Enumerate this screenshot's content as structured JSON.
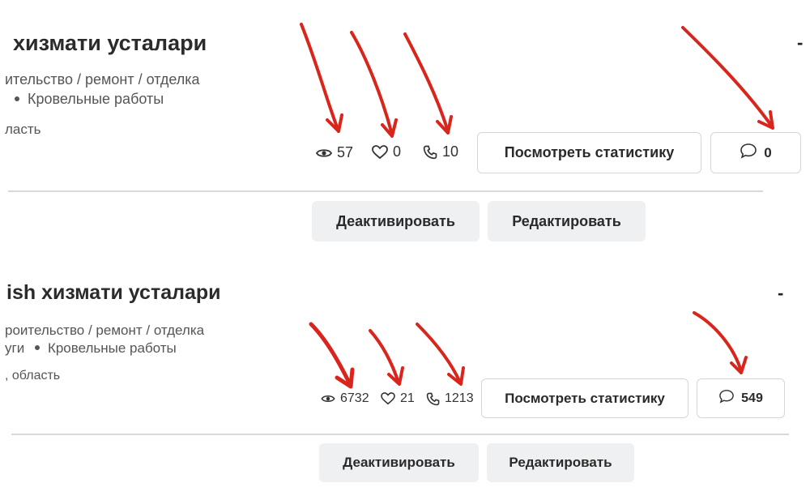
{
  "cards": [
    {
      "title": "хизмати усталари",
      "category_path": "ительство / ремонт / отделка",
      "subcategory": "Кровельные работы",
      "region": "ласть",
      "stats": {
        "views": "57",
        "likes": "0",
        "calls": "10"
      },
      "buttons": {
        "statistics": "Посмотреть статистику",
        "deactivate": "Деактивировать",
        "edit": "Редактировать"
      },
      "messages": "0",
      "more": "-"
    },
    {
      "title": "ish хизмати усталари",
      "category_path": "роительство / ремонт / отделка",
      "subcategory_prefix": "уги",
      "subcategory": "Кровельные работы",
      "region": ", область",
      "stats": {
        "views": "6732",
        "likes": "21",
        "calls": "1213"
      },
      "buttons": {
        "statistics": "Посмотреть статистику",
        "deactivate": "Деактивировать",
        "edit": "Редактировать"
      },
      "messages": "549",
      "more": "-"
    }
  ],
  "icons": {
    "views": "eye-icon",
    "likes": "heart-icon",
    "calls": "phone-icon",
    "messages": "chat-bubble-icon"
  },
  "colors": {
    "annotation_arrow": "#d9261c",
    "button_fill": "#eef0f2",
    "button_border": "#d6d6d6",
    "divider": "#d9d9d9"
  }
}
